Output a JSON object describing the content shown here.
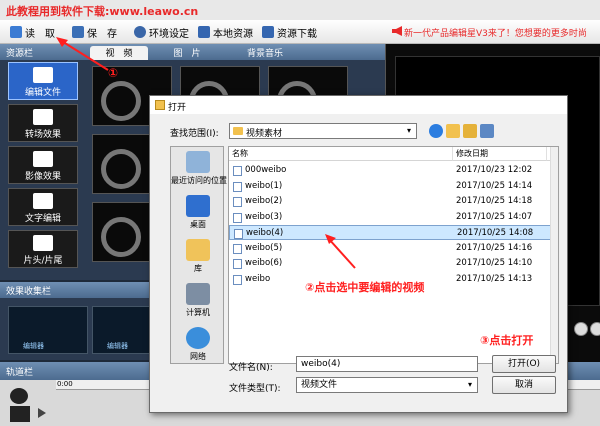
{
  "banner": {
    "text": "此教程用到软件下载:www.leawo.cn"
  },
  "toolbar": {
    "items": [
      {
        "label": "读　取",
        "icon": "open-folder-icon"
      },
      {
        "label": "保　存",
        "icon": "save-icon"
      },
      {
        "label": "环境设定",
        "icon": "gear-icon"
      },
      {
        "label": "本地资源",
        "icon": "upload-icon"
      },
      {
        "label": "资源下载",
        "icon": "download-icon"
      }
    ],
    "promo": "新一代产品编辑星V3来了！您想要的更多时尚"
  },
  "resource_panel": {
    "title": "资源栏",
    "tabs": [
      "视　频",
      "图　片",
      "背景音乐"
    ],
    "menu": [
      "编辑文件",
      "转场效果",
      "影像效果",
      "文字编辑",
      "片头/片尾"
    ]
  },
  "effect_panel": {
    "title": "效果收集栏",
    "thumb_label": "编辑器"
  },
  "timeline": {
    "title": "轨道栏",
    "zero": "0:00"
  },
  "dialog": {
    "title": "打开",
    "look_in_label": "查找范围(I):",
    "look_in_value": "视频素材",
    "places": [
      "最近访问的位置",
      "桌面",
      "库",
      "计算机",
      "网络"
    ],
    "columns": {
      "name": "名称",
      "date": "修改日期",
      "type": ""
    },
    "files": [
      {
        "name": "000weibo",
        "date": "2017/10/23 12:02",
        "type": "M"
      },
      {
        "name": "weibo(1)",
        "date": "2017/10/25 14:14",
        "type": "M"
      },
      {
        "name": "weibo(2)",
        "date": "2017/10/25 14:18",
        "type": "M"
      },
      {
        "name": "weibo(3)",
        "date": "2017/10/25 14:07",
        "type": "M"
      },
      {
        "name": "weibo(4)",
        "date": "2017/10/25 14:08",
        "type": "M"
      },
      {
        "name": "weibo(5)",
        "date": "2017/10/25 14:16",
        "type": "M"
      },
      {
        "name": "weibo(6)",
        "date": "2017/10/25 14:10",
        "type": "M"
      },
      {
        "name": "weibo",
        "date": "2017/10/25 14:13",
        "type": "M"
      }
    ],
    "selected_index": 4,
    "filename_label": "文件名(N):",
    "filename_value": "weibo(4)",
    "filetype_label": "文件类型(T):",
    "filetype_value": "视频文件",
    "open_button": "打开(O)",
    "cancel_button": "取消"
  },
  "annotations": {
    "step1": "①",
    "step2": "②点击选中要编辑的视频",
    "step3": "③点击打开"
  },
  "colors": {
    "accent_red": "#ff1f1f",
    "menu_active": "#2b65c8",
    "selection": "#cde8ff"
  }
}
